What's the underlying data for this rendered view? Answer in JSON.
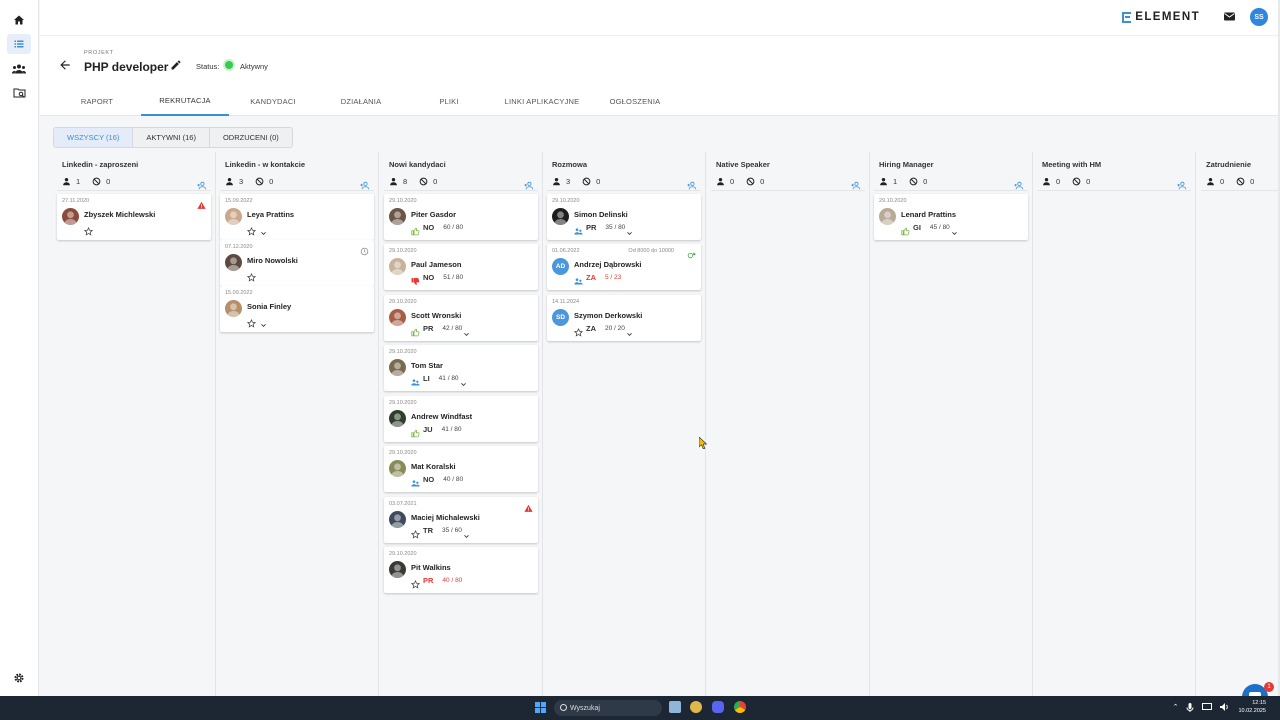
{
  "brand": {
    "name": "ELEMENT"
  },
  "user": {
    "initials": "SS"
  },
  "sidebar": {
    "items": [
      "home-icon",
      "list-icon",
      "people-icon",
      "search-folder-icon"
    ],
    "bottom": "settings-icon"
  },
  "project": {
    "label": "PROJEKT",
    "title": "PHP developer",
    "status_label": "Status:",
    "status_value": "Aktywny"
  },
  "tabs": [
    "RAPORT",
    "REKRUTACJA",
    "KANDYDACI",
    "DZIAŁANIA",
    "PLIKI",
    "LINKI APLIKACYJNE",
    "OGŁOSZENIA"
  ],
  "active_tab": "REKRUTACJA",
  "filters": [
    "WSZYSCY (16)",
    "AKTYWNI (16)",
    "ODRZUCENI (0)"
  ],
  "active_filter": "WSZYSCY (16)",
  "columns": [
    {
      "title": "Linkedin - zaproszeni",
      "candidates": "1",
      "rejected": "0",
      "cards": [
        {
          "date": "27.11.2020",
          "name": "Zbyszek Michlewski",
          "icon": "star",
          "code": "",
          "score": "",
          "flag": "warning",
          "avatar": "#8b4a3c"
        }
      ]
    },
    {
      "title": "Linkedin - w kontakcie",
      "candidates": "3",
      "rejected": "0",
      "cards": [
        {
          "date": "15.09.2022",
          "name": "Leya Prattins",
          "icon": "star",
          "code": "",
          "score": "",
          "chevron": true,
          "avatar": "#c8a98a"
        },
        {
          "date": "07.12.2020",
          "name": "Miro Nowolski",
          "icon": "star",
          "code": "",
          "score": "",
          "flag": "clock",
          "avatar": "#5c4a3f"
        },
        {
          "date": "15.09.2022",
          "name": "Sonia Finley",
          "icon": "star",
          "code": "",
          "score": "",
          "chevron": true,
          "avatar": "#b58f6a"
        }
      ]
    },
    {
      "title": "Nowi kandydaci",
      "candidates": "8",
      "rejected": "0",
      "cards": [
        {
          "date": "29.10.2020",
          "name": "Piter Gasdor",
          "icon": "thumb-up",
          "code": "NO",
          "score": "60 / 80",
          "avatar": "#6a5546"
        },
        {
          "date": "29.10.2020",
          "name": "Paul Jameson",
          "icon": "thumb-down",
          "code": "NO",
          "score": "51 / 80",
          "avatar": "#c7b39c"
        },
        {
          "date": "29.10.2020",
          "name": "Scott Wronski",
          "icon": "thumb-up",
          "code": "PR",
          "score": "42 / 80",
          "chevron": true,
          "avatar": "#a85e44"
        },
        {
          "date": "29.10.2020",
          "name": "Tom Star",
          "icon": "people",
          "code": "LI",
          "score": "41 / 80",
          "chevron": true,
          "avatar": "#7a6a4f"
        },
        {
          "date": "29.10.2020",
          "name": "Andrew Windfast",
          "icon": "thumb-up",
          "code": "JU",
          "score": "41 / 80",
          "avatar": "#2f3f2a"
        },
        {
          "date": "29.10.2020",
          "name": "Mat Koralski",
          "icon": "people",
          "code": "NO",
          "score": "40 / 80",
          "avatar": "#8a8a5a"
        },
        {
          "date": "03.07.2021",
          "name": "Maciej Michalewski",
          "icon": "star",
          "code": "TR",
          "score": "35 / 60",
          "chevron": true,
          "flag": "warning",
          "avatar": "#3e4b5c"
        },
        {
          "date": "29.10.2020",
          "name": "Pit Walkins",
          "icon": "star",
          "code": "PR",
          "score": "40 / 80",
          "red": true,
          "avatar": "#3a3a36"
        }
      ]
    },
    {
      "title": "Rozmowa",
      "candidates": "3",
      "rejected": "0",
      "cards": [
        {
          "date": "29.10.2020",
          "name": "Simon Delinski",
          "icon": "people",
          "code": "PR",
          "score": "35 / 80",
          "chevron": true,
          "avatar": "#1e1e1e"
        },
        {
          "date": "01.06.2022",
          "name": "Andrzej Dąbrowski",
          "icon": "people",
          "code": "ZA",
          "score": "5 / 23",
          "red": true,
          "note": "Od 8000 do 10000",
          "flag": "money",
          "initials": "AD",
          "avatar": "#4b96dc"
        },
        {
          "date": "14.11.2024",
          "name": "Szymon Derkowski",
          "icon": "star",
          "code": "ZA",
          "score": "20 / 20",
          "chevron": true,
          "initials": "SD",
          "avatar": "#4b96dc"
        }
      ]
    },
    {
      "title": "Native Speaker",
      "candidates": "0",
      "rejected": "0",
      "cards": []
    },
    {
      "title": "Hiring Manager",
      "candidates": "1",
      "rejected": "0",
      "cards": [
        {
          "date": "29.10.2020",
          "name": "Lenard Prattins",
          "icon": "thumb-up",
          "code": "GI",
          "score": "45 / 80",
          "chevron": true,
          "avatar": "#b9aa97"
        }
      ]
    },
    {
      "title": "Meeting with HM",
      "candidates": "0",
      "rejected": "0",
      "cards": []
    },
    {
      "title": "Zatrudnienie",
      "candidates": "0",
      "rejected": "0",
      "cards": []
    }
  ],
  "chat": {
    "badge": "1"
  },
  "taskbar": {
    "search_placeholder": "Wyszukaj",
    "time": "12:15",
    "date": "10.02.2025"
  }
}
